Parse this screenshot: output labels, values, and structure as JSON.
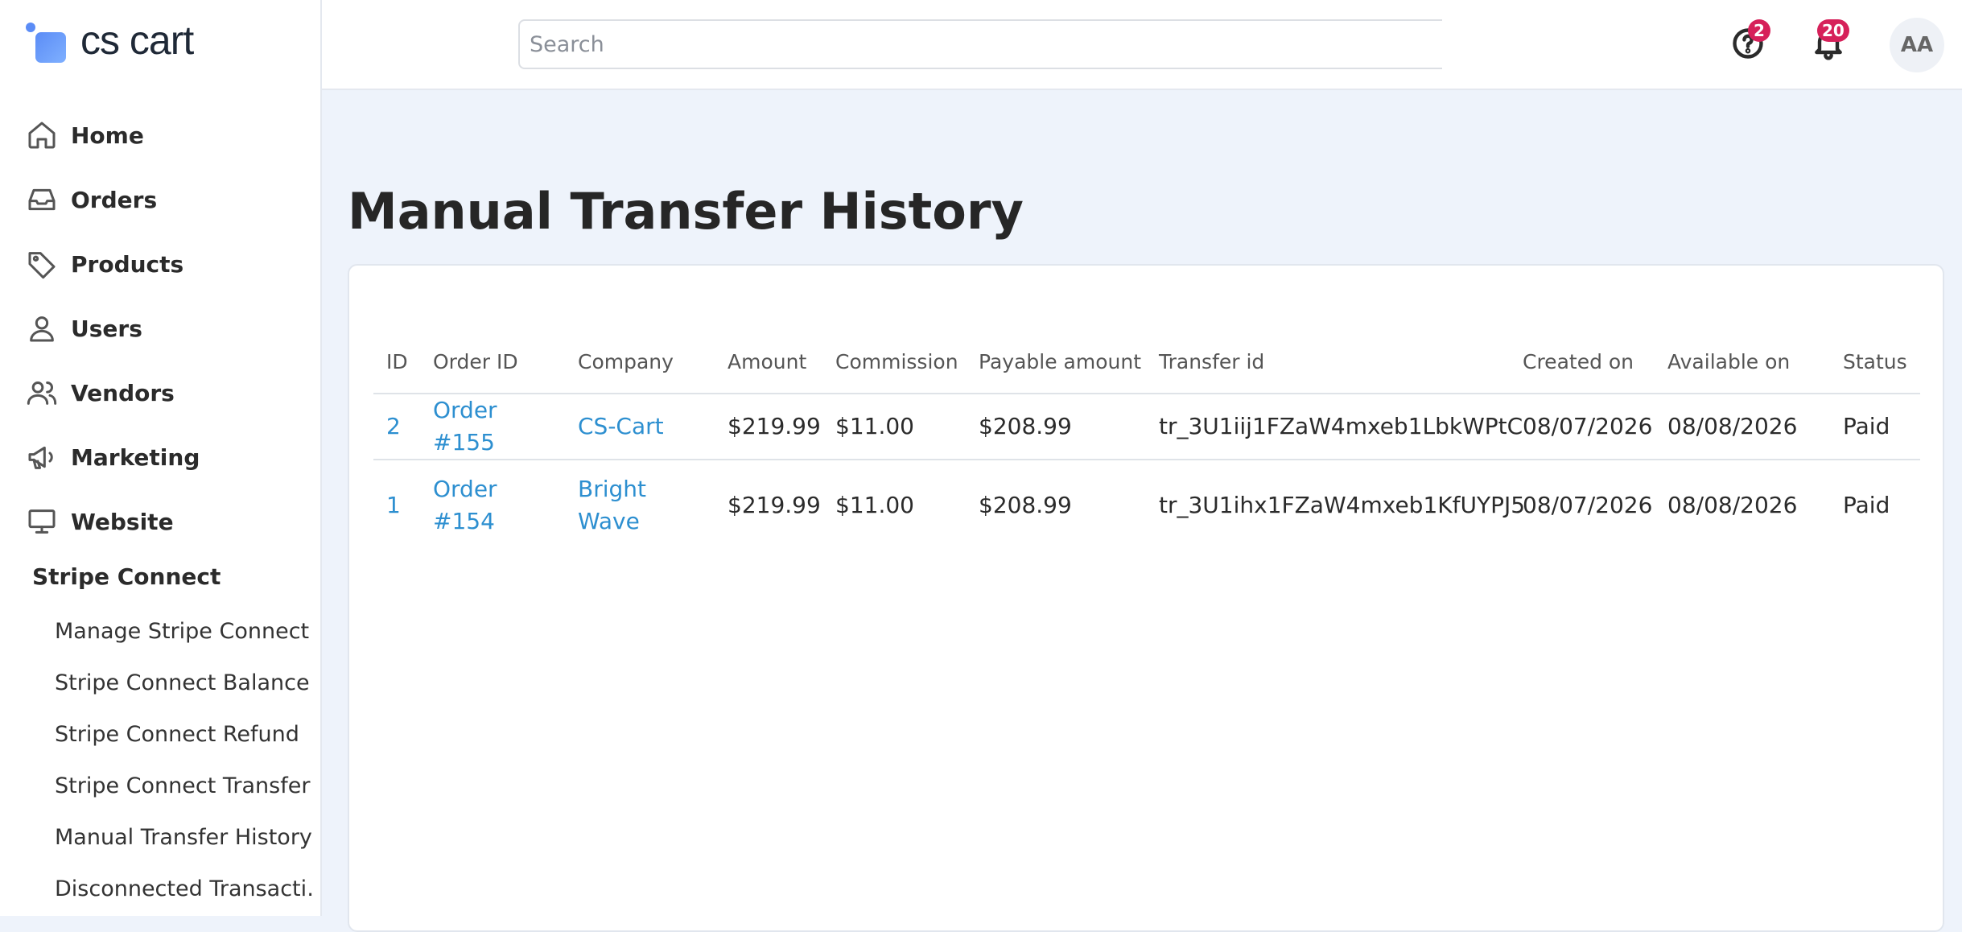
{
  "app": {
    "logo_text": "cs cart"
  },
  "sidebar": {
    "items": [
      {
        "label": "Home",
        "icon": "home-icon"
      },
      {
        "label": "Orders",
        "icon": "inbox-icon"
      },
      {
        "label": "Products",
        "icon": "tag-icon"
      },
      {
        "label": "Users",
        "icon": "user-icon"
      },
      {
        "label": "Vendors",
        "icon": "users-icon"
      },
      {
        "label": "Marketing",
        "icon": "megaphone-icon"
      },
      {
        "label": "Website",
        "icon": "monitor-icon"
      }
    ],
    "submenu_title": "Stripe Connect",
    "submenu": [
      "Manage Stripe Connect",
      "Stripe Connect Balance",
      "Stripe Connect Refund",
      "Stripe Connect Transfer",
      "Manual Transfer History",
      "Disconnected Transacti…"
    ]
  },
  "header": {
    "search_placeholder": "Search",
    "help_badge": "2",
    "notifications_badge": "20",
    "avatar_initials": "AA"
  },
  "main": {
    "title": "Manual Transfer History",
    "table": {
      "headers": [
        "ID",
        "Order ID",
        "Company",
        "Amount",
        "Commission",
        "Payable amount",
        "Transfer id",
        "Created on",
        "Available on",
        "Status"
      ],
      "rows": [
        [
          "2",
          "Order #155",
          "CS-Cart",
          "$219.99",
          "$11.00",
          "$208.99",
          "tr_3U1iij1FZaW4mxeb1LbkWPtC",
          "08/07/2026",
          "08/08/2026",
          "Paid"
        ],
        [
          "1",
          "Order #154",
          "Bright Wave",
          "$219.99",
          "$11.00",
          "$208.99",
          "tr_3U1ihx1FZaW4mxeb1KfUYPJ5",
          "08/07/2026",
          "08/08/2026",
          "Paid"
        ]
      ]
    }
  },
  "colors": {
    "accent_link": "#2d8fd0",
    "badge": "#d6215a",
    "background": "#eef3fb"
  }
}
